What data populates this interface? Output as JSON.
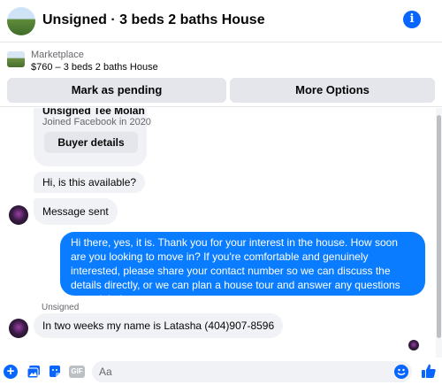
{
  "header": {
    "title": "Unsigned · 3 beds 2 baths House",
    "info_icon_label": "i"
  },
  "marketplace": {
    "label": "Marketplace",
    "listing": "$760 – 3 beds 2 baths House",
    "mark_pending_label": "Mark as pending",
    "more_options_label": "More Options"
  },
  "profile_card": {
    "name": "Unsigned Tee Molan",
    "joined": "Joined Facebook in 2020",
    "buyer_details_label": "Buyer details"
  },
  "messages": {
    "m1": "Hi, is this available?",
    "m2": "Message sent",
    "m3": "Hi there, yes, it is. Thank you for your interest in the house. How soon are you looking to move in? If you're comfortable and genuinely interested, please share your contact number so we can discuss the details directly, or we can plan a house tour and answer any questions you might have.",
    "sender": "Unsigned",
    "m4": "In two weeks my name is Latasha (404)907-8596"
  },
  "composer": {
    "placeholder": "Aa",
    "gif_label": "GIF",
    "plus_label": "+"
  },
  "colors": {
    "accent": "#0866ff",
    "outgoing_bubble": "#0a7cff",
    "incoming_bubble": "#f0f2f5"
  }
}
